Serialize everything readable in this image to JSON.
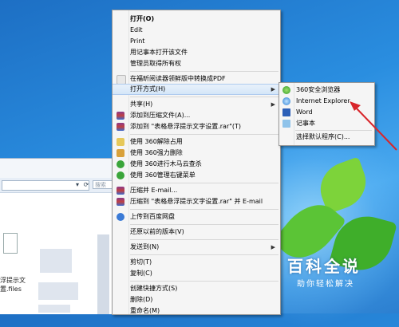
{
  "explorer": {
    "search_placeholder": "搜索",
    "file_name_line1": "浮提示文",
    "file_name_line2": "置.files"
  },
  "context_menu": {
    "items": [
      {
        "label": "打开(O)",
        "bold": true
      },
      {
        "label": "Edit"
      },
      {
        "label": "Print"
      },
      {
        "label": "用记事本打开该文件"
      },
      {
        "label": "管理员取得所有权"
      },
      {
        "label": "在福昕阅读器领鲜版中转换成PDF"
      },
      {
        "label": "打开方式(H)",
        "submenu": true
      },
      {
        "label": "共享(H)",
        "submenu": true
      },
      {
        "label": "添加到压缩文件(A)..."
      },
      {
        "label": "添加到 \"表格悬浮提示文字设置.rar\"(T)"
      },
      {
        "label": "使用 360解除占用"
      },
      {
        "label": "使用 360强力删除"
      },
      {
        "label": "使用 360进行木马云查杀"
      },
      {
        "label": "使用 360管理右键菜单"
      },
      {
        "label": "压缩并 E-mail..."
      },
      {
        "label": "压缩到 \"表格悬浮提示文字设置.rar\" 并 E-mail"
      },
      {
        "label": "上传到百度网盘"
      },
      {
        "label": "还原以前的版本(V)"
      },
      {
        "label": "发送到(N)",
        "submenu": true
      },
      {
        "label": "剪切(T)"
      },
      {
        "label": "复制(C)"
      },
      {
        "label": "创建快捷方式(S)"
      },
      {
        "label": "删除(D)"
      },
      {
        "label": "重命名(M)"
      }
    ]
  },
  "open_with_submenu": {
    "items": [
      {
        "label": "360安全浏览器"
      },
      {
        "label": "Internet Explorer"
      },
      {
        "label": "Word"
      },
      {
        "label": "记事本"
      },
      {
        "label": "选择默认程序(C)..."
      }
    ]
  },
  "watermark": {
    "title": "百科全说",
    "subtitle": "助你轻松解决"
  },
  "colors": {
    "desktop": "#2a8ee0",
    "highlight": "#d4e6f8",
    "arrow": "#d8262b"
  }
}
